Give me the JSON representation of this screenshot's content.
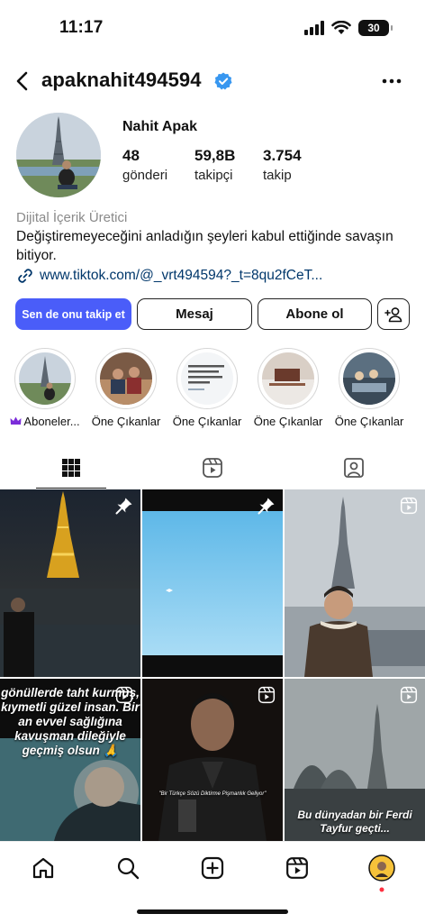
{
  "status_bar": {
    "time": "11:17",
    "battery": "30"
  },
  "header": {
    "username": "apaknahit494594"
  },
  "profile": {
    "name": "Nahit Apak",
    "stats": [
      {
        "value": "48",
        "label": "gönderi"
      },
      {
        "value": "59,8B",
        "label": "takipçi"
      },
      {
        "value": "3.754",
        "label": "takip"
      }
    ],
    "category": "Dijital İçerik Üretici",
    "bio": "Değiştiremeyeceğini anladığın şeyleri kabul ettiğinde savaşın bitiyor.",
    "link": "www.tiktok.com/@_vrt494594?_t=8qu2fCeT..."
  },
  "actions": {
    "follow_label": "Sen de onu takip et",
    "message_label": "Mesaj",
    "subscribe_label": "Abone ol"
  },
  "highlights": [
    {
      "label": "Aboneler...",
      "subscribers_only": true
    },
    {
      "label": "Öne Çıkanlar"
    },
    {
      "label": "Öne Çıkanlar"
    },
    {
      "label": "Öne Çıkanlar"
    },
    {
      "label": "Öne Çıkanlar"
    }
  ],
  "posts": {
    "caption_4_lines": [
      "gönüllerde taht kurmuş,",
      "kıymetli güzel insan. Bir",
      "an evvel sağlığına",
      "kavuşman dileğiyle",
      "geçmiş olsun 🙏"
    ],
    "caption_5": "\"Bir Türkçe Sözü Diktirme Pişmanlık Geliyor\"",
    "caption_6_lines": [
      "Bu dünyadan bir Ferdi",
      "Tayfur geçti..."
    ]
  },
  "colors": {
    "accent": "#4a5df9",
    "link": "#00376b",
    "verified": "#3897f0",
    "subscriber_crown": "#7b2cd9"
  },
  "icons": [
    "back-arrow-icon",
    "verified-badge-icon",
    "more-icon",
    "link-icon",
    "add-user-icon",
    "grid-icon",
    "reels-icon",
    "tagged-icon",
    "pin-icon",
    "home-icon",
    "search-icon",
    "create-icon",
    "profile-icon"
  ]
}
